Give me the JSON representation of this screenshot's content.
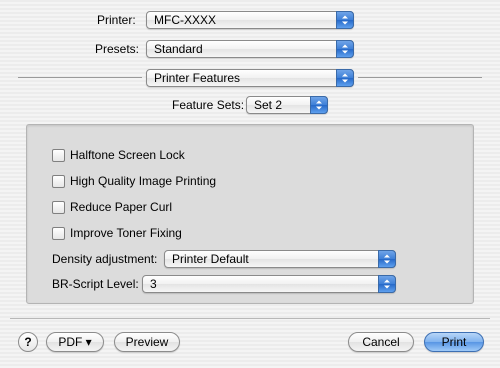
{
  "printer": {
    "label": "Printer:",
    "value": "MFC-XXXX"
  },
  "presets": {
    "label": "Presets:",
    "value": "Standard"
  },
  "pane": {
    "value": "Printer Features"
  },
  "feature_sets": {
    "label": "Feature Sets:",
    "value": "Set 2"
  },
  "options": [
    {
      "label": "Halftone Screen Lock",
      "checked": false
    },
    {
      "label": "High Quality Image Printing",
      "checked": false
    },
    {
      "label": "Reduce Paper Curl",
      "checked": false
    },
    {
      "label": "Improve Toner Fixing",
      "checked": false
    }
  ],
  "density": {
    "label": "Density adjustment:",
    "value": "Printer Default"
  },
  "br_script": {
    "label": "BR-Script Level:",
    "value": "3"
  },
  "footer": {
    "help_label": "?",
    "pdf_label": "PDF ▾",
    "preview_label": "Preview",
    "cancel_label": "Cancel",
    "print_label": "Print"
  },
  "colors": {
    "accent": "#3d7fd7",
    "default_button": "#7fb2ef"
  }
}
